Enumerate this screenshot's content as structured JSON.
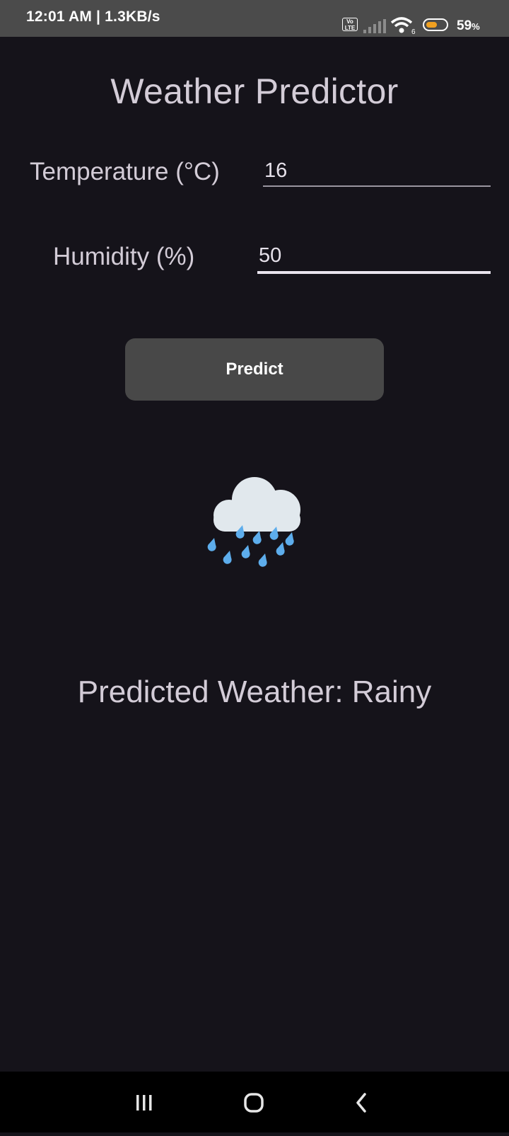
{
  "status_bar": {
    "time_speed": "12:01 AM | 1.3KB/s",
    "volte_label": "Vo\nLTE",
    "wifi_badge": "6",
    "battery_percent": "59",
    "battery_level": 0.59,
    "battery_unit": "%",
    "icons": [
      "volte-icon",
      "signal-icon",
      "wifi-icon",
      "battery-icon"
    ]
  },
  "app": {
    "title": "Weather Predictor",
    "temperature": {
      "label": "Temperature (°C)",
      "value": "16"
    },
    "humidity": {
      "label": "Humidity (%)",
      "value": "50"
    },
    "predict_button": "Predict",
    "weather_icon": "cloud-rain-icon",
    "result_prefix": "Predicted Weather: ",
    "result_value": "Rainy"
  },
  "colors": {
    "background": "#15131a",
    "status_bar": "#4b4b4b",
    "button": "#484848",
    "text": "#d3ccd7",
    "cloud": "#e1e8ed",
    "rain": "#5dadec",
    "battery": "#f0a020"
  },
  "nav_bar": {
    "icons": [
      "recents-icon",
      "home-icon",
      "back-icon"
    ]
  }
}
